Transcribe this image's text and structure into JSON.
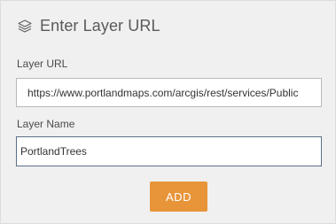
{
  "header": {
    "icon": "layers-icon",
    "title": "Enter Layer URL"
  },
  "fields": {
    "url": {
      "label": "Layer URL",
      "value": "https://www.portlandmaps.com/arcgis/rest/services/Public"
    },
    "name": {
      "label": "Layer Name",
      "value": "PortlandTrees"
    }
  },
  "actions": {
    "add_label": "ADD",
    "add_color": "#e8953a"
  }
}
